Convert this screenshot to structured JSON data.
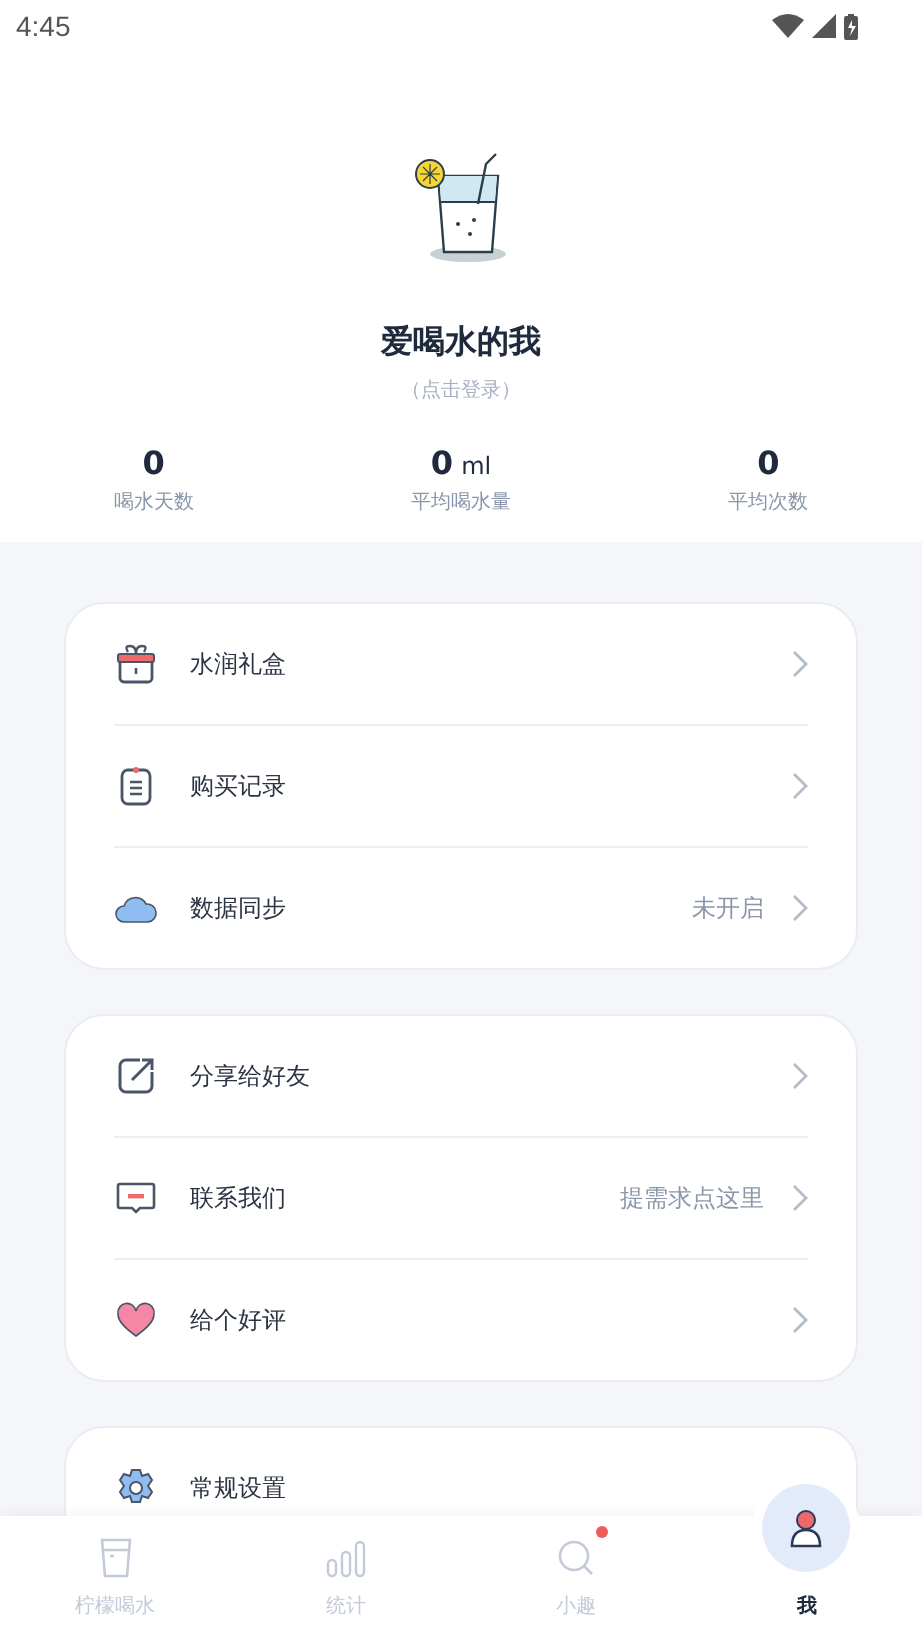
{
  "status_bar": {
    "time": "4:45"
  },
  "profile": {
    "name": "爱喝水的我",
    "login_hint": "（点击登录）"
  },
  "stats": [
    {
      "value": "0",
      "label": "喝水天数"
    },
    {
      "value": "0",
      "unit": "ml",
      "label": "平均喝水量"
    },
    {
      "value": "0",
      "label": "平均次数"
    }
  ],
  "menu_groups": [
    [
      {
        "label": "水润礼盒"
      },
      {
        "label": "购买记录"
      },
      {
        "label": "数据同步",
        "value": "未开启"
      }
    ],
    [
      {
        "label": "分享给好友"
      },
      {
        "label": "联系我们",
        "value": "提需求点这里"
      },
      {
        "label": "给个好评"
      }
    ],
    [
      {
        "label": "常规设置"
      }
    ]
  ],
  "tabs": [
    {
      "label": "柠檬喝水",
      "selected": false,
      "badge": false
    },
    {
      "label": "统计",
      "selected": false,
      "badge": false
    },
    {
      "label": "小趣",
      "selected": false,
      "badge": true
    },
    {
      "label": "我",
      "selected": true,
      "badge": false
    }
  ]
}
